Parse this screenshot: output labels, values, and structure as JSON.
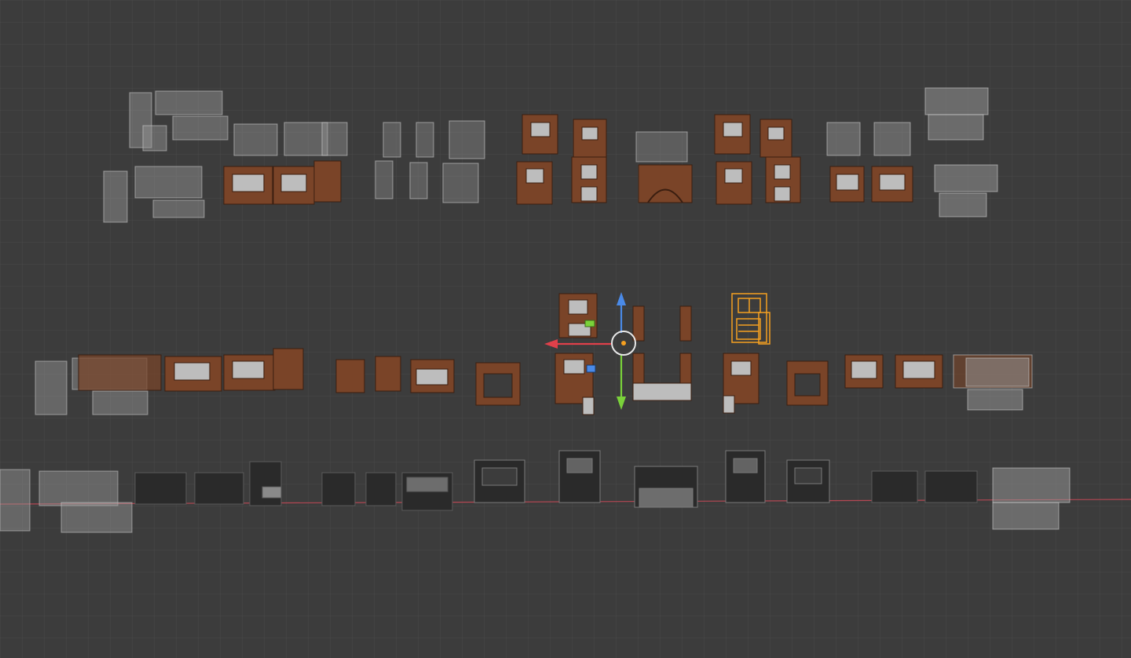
{
  "viewport": {
    "name": "3D Viewport",
    "shading_mode": "solid",
    "background_color": "#3c3c3c",
    "grid_color": "#4c4c4c",
    "x_axis_color": "#b44753",
    "selection_color": "#f5a020",
    "wood_color": "#7a4428",
    "ghost_color": "#9a9a9a",
    "dark_color": "#2a2a2a"
  },
  "gizmo": {
    "type": "move",
    "x_axis_color": "#e0404a",
    "y_axis_color": "#7ad23a",
    "z_axis_color": "#4a8ae8",
    "pivot_color": "#f5a020",
    "icons": [
      "move-x-arrow-icon",
      "move-y-arrow-icon",
      "move-z-arrow-icon",
      "plane-xy-handle-icon",
      "plane-yz-handle-icon",
      "origin-pivot-icon"
    ]
  },
  "selected_object": {
    "style": "wireframe-outline",
    "color": "#f5a020"
  }
}
